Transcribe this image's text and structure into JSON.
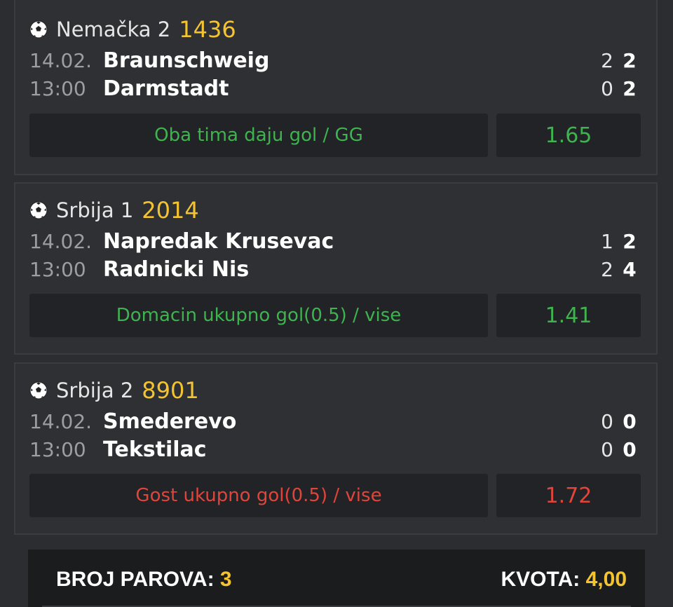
{
  "colors": {
    "background": "#2b2d30",
    "card": "#2e3033",
    "tip_box": "#222326",
    "accent_yellow": "#f4c430",
    "win_green": "#3fb34f",
    "loss_red": "#e0453b"
  },
  "matches": [
    {
      "icon": "soccer-ball-icon",
      "league": "Nemačka 2",
      "code": "1436",
      "date": "14.02.",
      "time": "13:00",
      "home": "Braunschweig",
      "away": "Darmstadt",
      "home_ht": "2",
      "home_ft": "2",
      "away_ht": "0",
      "away_ft": "2",
      "tip": "Oba tima daju gol / GG",
      "odd": "1.65",
      "status": "won"
    },
    {
      "icon": "soccer-ball-icon",
      "league": "Srbija 1",
      "code": "2014",
      "date": "14.02.",
      "time": "13:00",
      "home": "Napredak Krusevac",
      "away": "Radnicki Nis",
      "home_ht": "1",
      "home_ft": "2",
      "away_ht": "2",
      "away_ft": "4",
      "tip": "Domacin ukupno gol(0.5) / vise",
      "odd": "1.41",
      "status": "won"
    },
    {
      "icon": "soccer-ball-icon",
      "league": "Srbija 2",
      "code": "8901",
      "date": "14.02.",
      "time": "13:00",
      "home": "Smederevo",
      "away": "Tekstilac",
      "home_ht": "0",
      "home_ft": "0",
      "away_ht": "0",
      "away_ft": "0",
      "tip": "Gost ukupno gol(0.5) / vise",
      "odd": "1.72",
      "status": "lost"
    }
  ],
  "summary": {
    "pairs_label": "BROJ PAROVA:",
    "pairs_value": "3",
    "odds_label": "KVOTA:",
    "odds_value": "4,00"
  }
}
